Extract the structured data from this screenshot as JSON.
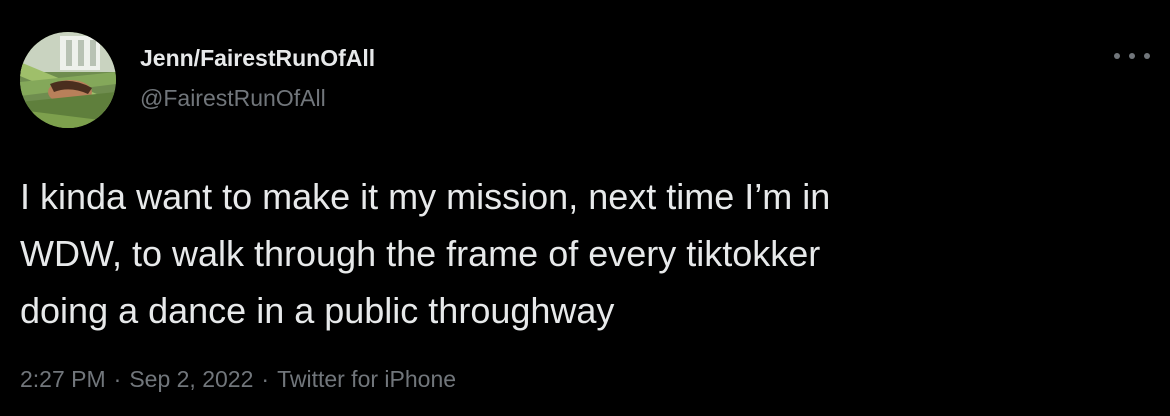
{
  "author": {
    "display_name": "Jenn/FairestRunOfAll",
    "handle": "@FairestRunOfAll",
    "avatar_icon": "profile-photo"
  },
  "menu": {
    "icon": "more-options-icon"
  },
  "tweet": {
    "text": "I kinda want to make it my mission, next time I’m in\nWDW, to walk through the frame of every tiktokker\ndoing a dance in a public throughway"
  },
  "meta": {
    "time": "2:27 PM",
    "separator": "·",
    "date": "Sep 2, 2022",
    "source": "Twitter for iPhone"
  },
  "colors": {
    "background": "#000000",
    "primary_text": "#e7e9ea",
    "secondary_text": "#71767b"
  }
}
